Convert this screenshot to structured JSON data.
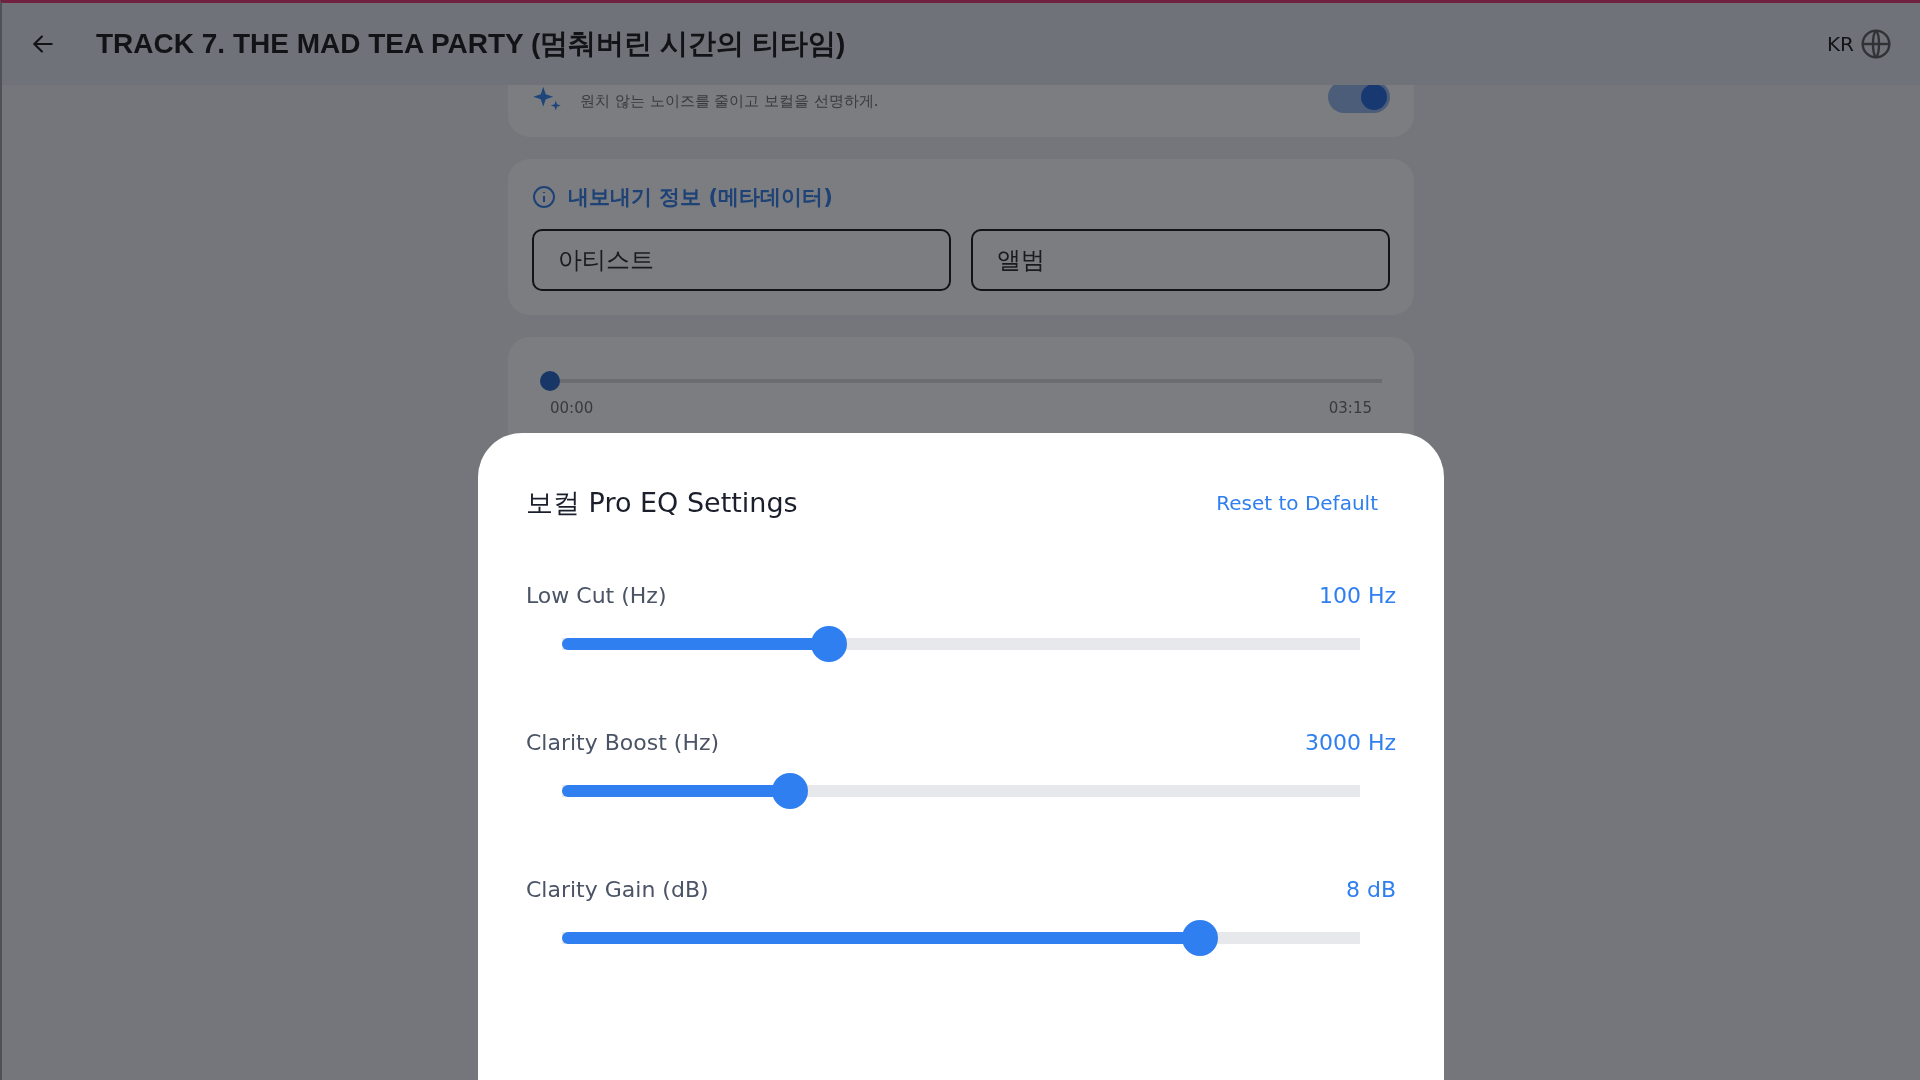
{
  "header": {
    "title": "TRACK 7. THE MAD TEA PARTY (멈춰버린 시간의 티타임)",
    "language": "KR"
  },
  "enhance_card": {
    "description": "원치 않는 노이즈를 줄이고 보컬을 선명하게.",
    "on": true
  },
  "metadata_card": {
    "title": "내보내기 정보 (메타데이터)",
    "fields": [
      {
        "placeholder": "아티스트"
      },
      {
        "placeholder": "앨범"
      }
    ]
  },
  "player": {
    "level": 0,
    "elapsed": "00:00",
    "duration": "03:15"
  },
  "eq_sheet": {
    "title": "보컬 Pro EQ Settings",
    "reset": "Reset to Default",
    "sliders": [
      {
        "label": "Low Cut (Hz)",
        "reading": "100 Hz",
        "level": 0.334
      },
      {
        "label": "Clarity Boost (Hz)",
        "reading": "3000 Hz",
        "level": 0.286
      },
      {
        "label": "Clarity Gain (dB)",
        "reading": "8 dB",
        "level": 0.8
      }
    ]
  }
}
